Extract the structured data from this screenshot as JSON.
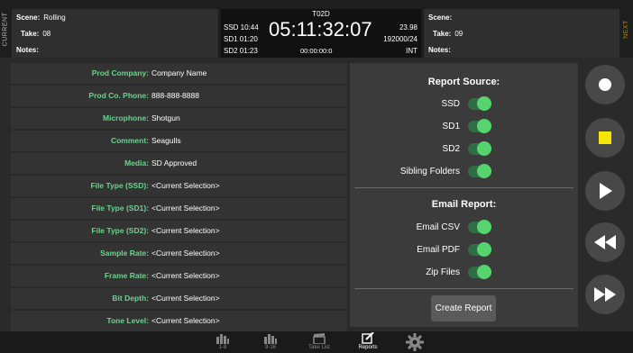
{
  "header": {
    "current_label": "CURRENT",
    "next_label": "NEXT",
    "current": {
      "scene_label": "Scene:",
      "scene_value": "Rolling",
      "take_label": "Take:",
      "take_value": "08",
      "notes_label": "Notes:",
      "notes_value": ""
    },
    "next": {
      "scene_label": "Scene:",
      "scene_value": "",
      "take_label": "Take:",
      "take_value": "09",
      "notes_label": "Notes:",
      "notes_value": ""
    },
    "timecode": {
      "filename": "T02D",
      "main": "05:11:32:07",
      "sub": "00:00:00:0",
      "ssd": "SSD 10:44",
      "sd1": "SD1 01:20",
      "sd2": "SD2 01:23",
      "frame_rate": "23.98",
      "sample_format": "192000/24",
      "tc_mode": "INT"
    }
  },
  "metadata": [
    {
      "label": "Prod Company:",
      "value": "Company Name"
    },
    {
      "label": "Prod Co. Phone:",
      "value": "888-888-8888"
    },
    {
      "label": "Microphone:",
      "value": "Shotgun"
    },
    {
      "label": "Comment:",
      "value": "Seagulls"
    },
    {
      "label": "Media:",
      "value": "SD Approved"
    },
    {
      "label": "File Type (SSD):",
      "value": "<Current Selection>"
    },
    {
      "label": "File Type (SD1):",
      "value": "<Current Selection>"
    },
    {
      "label": "File Type (SD2):",
      "value": "<Current Selection>"
    },
    {
      "label": "Sample Rate:",
      "value": "<Current Selection>"
    },
    {
      "label": "Frame Rate:",
      "value": "<Current Selection>"
    },
    {
      "label": "Bit Depth:",
      "value": "<Current Selection>"
    },
    {
      "label": "Tone Level:",
      "value": "<Current Selection>"
    }
  ],
  "report_source": {
    "title": "Report Source:",
    "options": [
      {
        "label": "SSD",
        "on": true
      },
      {
        "label": "SD1",
        "on": true
      },
      {
        "label": "SD2",
        "on": true
      },
      {
        "label": "Sibling Folders",
        "on": true
      }
    ]
  },
  "email_report": {
    "title": "Email Report:",
    "options": [
      {
        "label": "Email CSV",
        "on": true
      },
      {
        "label": "Email PDF",
        "on": true
      },
      {
        "label": "Zip Files",
        "on": true
      }
    ]
  },
  "create_report_label": "Create Report",
  "transport": {
    "record_icon": "record-icon",
    "stop_icon": "stop-icon",
    "play_icon": "play-icon",
    "rewind_icon": "rewind-icon",
    "fast_forward_icon": "fast-forward-icon",
    "stop_color": "#f5e60a",
    "accent_green": "#57d46d"
  },
  "bottom_nav": [
    {
      "icon": "meter-icon",
      "label": "1-8"
    },
    {
      "icon": "meter-icon",
      "label": "9-16"
    },
    {
      "icon": "clapper-icon",
      "label": "Take List"
    },
    {
      "icon": "edit-icon",
      "label": "Reports"
    },
    {
      "icon": "gear-icon",
      "label": ""
    }
  ]
}
